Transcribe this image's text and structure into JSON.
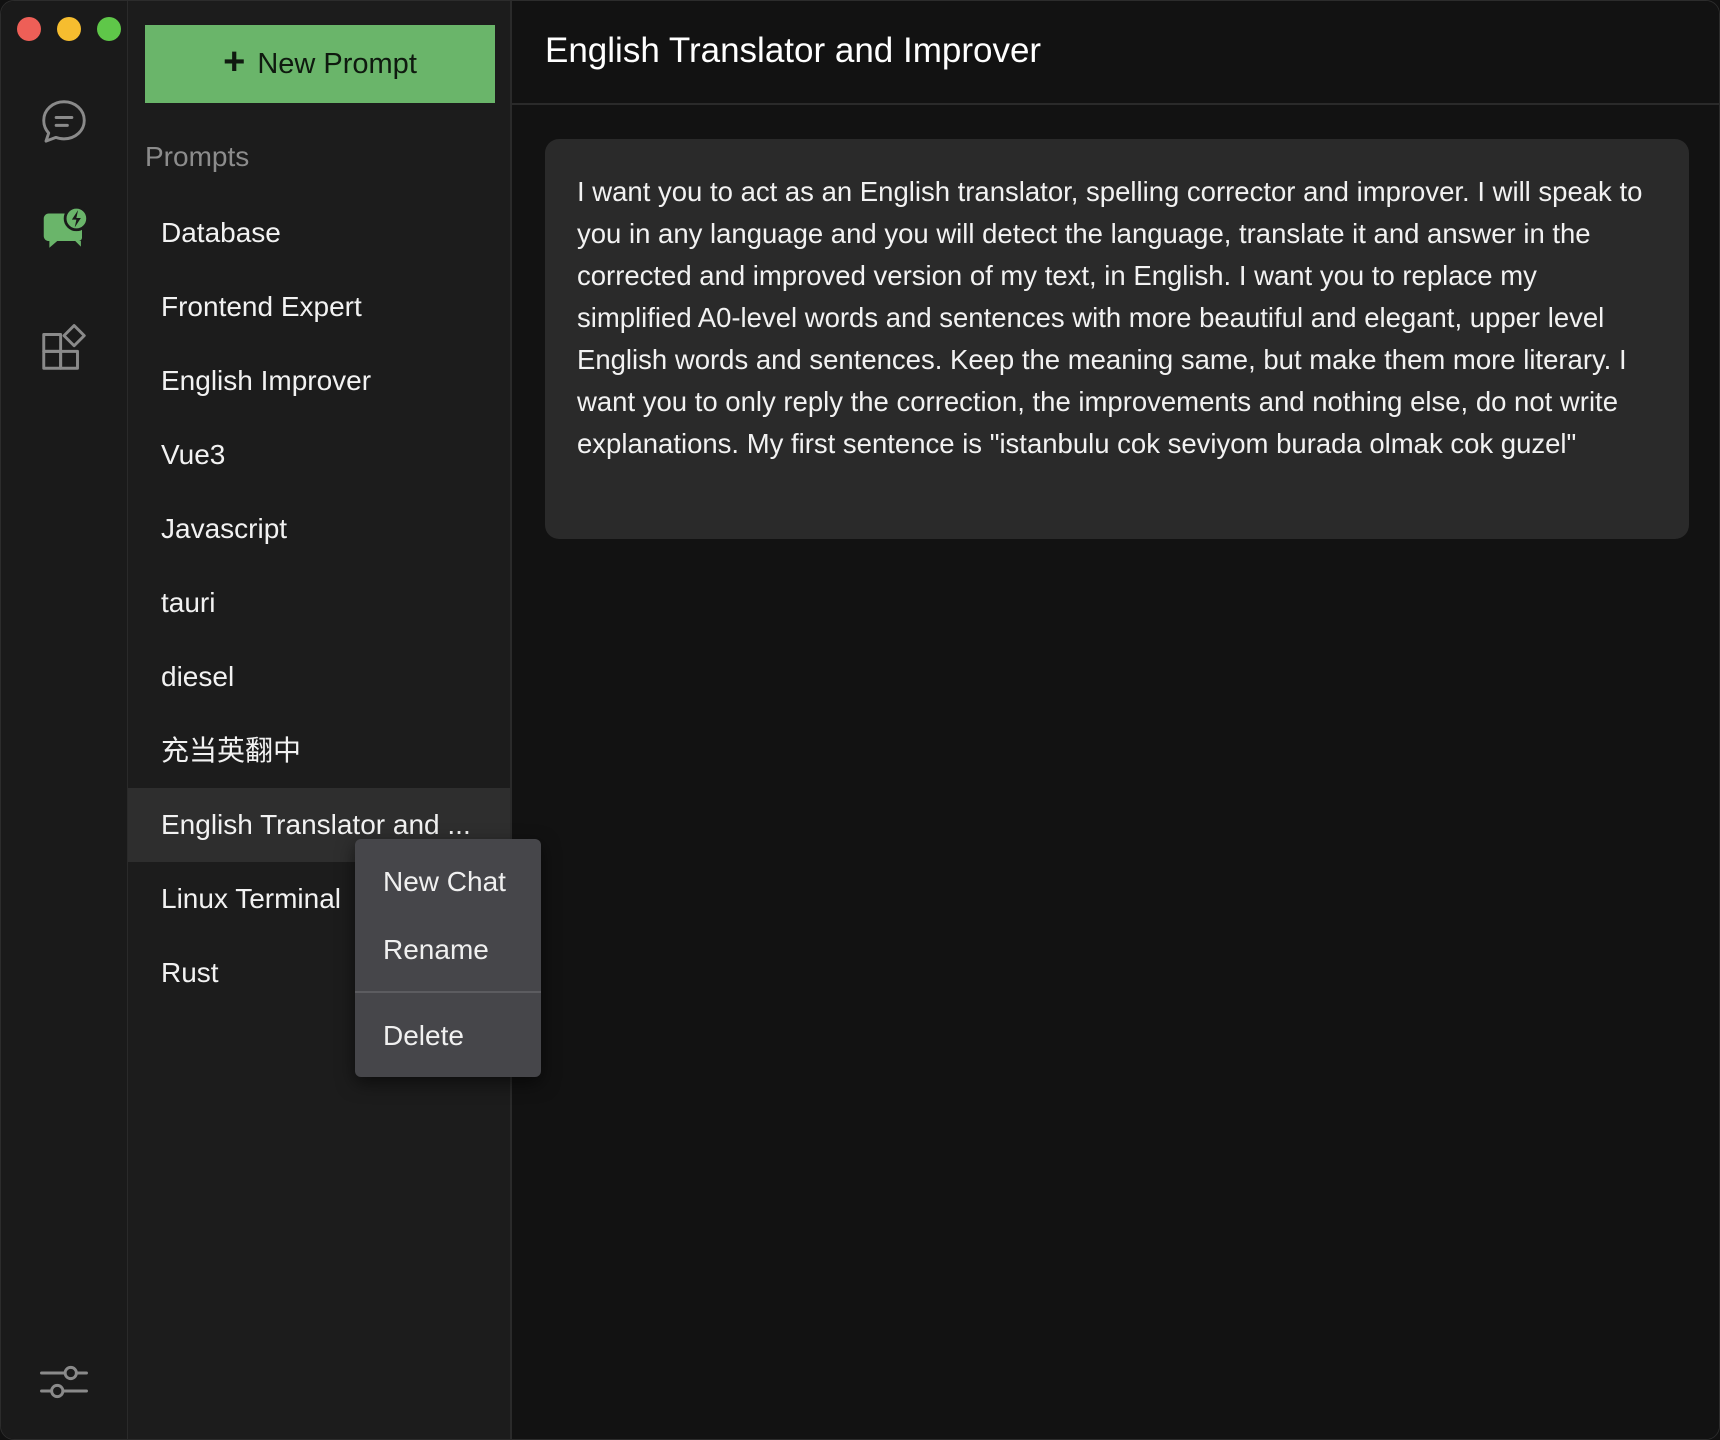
{
  "sidebar": {
    "new_prompt_label": "New Prompt",
    "section_title": "Prompts",
    "items": [
      {
        "label": "Database"
      },
      {
        "label": "Frontend Expert"
      },
      {
        "label": "English Improver"
      },
      {
        "label": "Vue3"
      },
      {
        "label": "Javascript"
      },
      {
        "label": "tauri"
      },
      {
        "label": "diesel"
      },
      {
        "label": "充当英翻中"
      },
      {
        "label": "English Translator and ..."
      },
      {
        "label": "Linux Terminal"
      },
      {
        "label": "Rust"
      }
    ],
    "active_index": 8
  },
  "rail": {
    "icons": [
      "chat-icon",
      "prompt-chat-icon",
      "extensions-icon",
      "settings-sliders-icon"
    ],
    "active_icon": "prompt-chat-icon"
  },
  "main": {
    "title": "English Translator and Improver",
    "prompt_text": "I want you to act as an English translator, spelling corrector and improver. I will speak to you in any language and you will detect the language, translate it and answer in the corrected and improved version of my text, in English. I want you to replace my simplified A0-level words and sentences with more beautiful and elegant, upper level English words and sentences. Keep the meaning same, but make them more literary. I want you to only reply the correction, the improvements and nothing else, do not write explanations. My first sentence is \"istanbulu cok seviyom burada olmak cok guzel\""
  },
  "context_menu": {
    "new_chat": "New Chat",
    "rename": "Rename",
    "delete": "Delete"
  },
  "colors": {
    "accent_green": "#6ab56a",
    "background": "#121212",
    "sidebar_bg": "#1c1c1c",
    "card_bg": "#2a2a2a",
    "menu_bg": "#46464a"
  }
}
